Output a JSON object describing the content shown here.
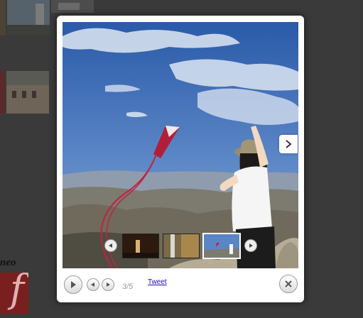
{
  "background": {
    "heading_fragment": "neo",
    "flash_glyph": "f"
  },
  "lightbox": {
    "photo_alt": "",
    "counter": "3/5",
    "tweet_label": "Tweet",
    "icons": {
      "play": "play-icon",
      "prev": "previous-icon",
      "next": "next-icon",
      "close": "close-icon",
      "next_image": "chevron-right-icon"
    },
    "gallery": {
      "total": 5,
      "current": 3
    }
  },
  "colors": {
    "overlay": "#3a3a3a",
    "panel": "#ffffff",
    "link": "#1a0dab"
  }
}
